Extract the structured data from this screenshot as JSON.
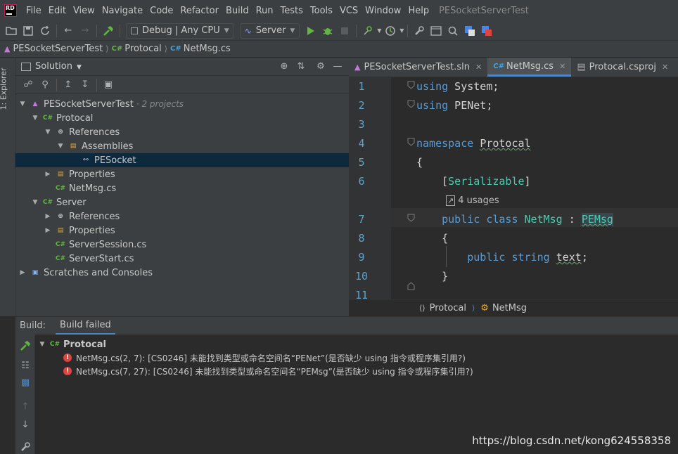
{
  "menubar": {
    "logo": "RD",
    "items": [
      "File",
      "Edit",
      "View",
      "Navigate",
      "Code",
      "Refactor",
      "Build",
      "Run",
      "Tests",
      "Tools",
      "VCS",
      "Window",
      "Help"
    ],
    "window_title": "PESocketServerTest"
  },
  "toolbar": {
    "config": "Debug | Any CPU",
    "run_target": "Server"
  },
  "breadcrumb": {
    "items": [
      "PESocketServerTest",
      "Protocal",
      "NetMsg.cs"
    ]
  },
  "left_stripe": {
    "tab": "1: Explorer"
  },
  "solution": {
    "title": "Solution",
    "tree": [
      {
        "label": "PESocketServerTest",
        "note": "· 2 projects"
      },
      {
        "label": "Protocal"
      },
      {
        "label": "References"
      },
      {
        "label": "Assemblies"
      },
      {
        "label": "PESocket"
      },
      {
        "label": "Properties"
      },
      {
        "label": "NetMsg.cs"
      },
      {
        "label": "Server"
      },
      {
        "label": "References"
      },
      {
        "label": "Properties"
      },
      {
        "label": "ServerSession.cs"
      },
      {
        "label": "ServerStart.cs"
      },
      {
        "label": "Scratches and Consoles"
      }
    ]
  },
  "editor": {
    "tabs": [
      "PESocketServerTest.sln",
      "NetMsg.cs",
      "Protocal.csproj",
      "C#"
    ],
    "line_numbers": [
      "1",
      "2",
      "3",
      "4",
      "5",
      "6",
      "7",
      "8",
      "9",
      "10",
      "11"
    ],
    "code": {
      "l1_kw": "using",
      "l1_rest": " System;",
      "l2_kw": "using",
      "l2_rest": " PENet;",
      "l4_kw": "namespace",
      "l4_name": "Protocal",
      "l5": "{",
      "l6_open": "[",
      "l6_attr": "Serializable",
      "l6_close": "]",
      "usages": "4 usages",
      "l7_kw1": "public",
      "l7_kw2": "class",
      "l7_name": "NetMsg",
      "l7_colon": " : ",
      "l7_base": "PEMsg",
      "l8": "{",
      "l9_kw1": "public",
      "l9_kw2": "string",
      "l9_field": "text",
      "l9_end": ";",
      "l10": "}"
    },
    "code_breadcrumb": [
      "Protocal",
      "NetMsg"
    ]
  },
  "build": {
    "label": "Build:",
    "tab": "Build failed",
    "project": "Protocal",
    "errors": [
      "NetMsg.cs(2, 7): [CS0246] 未能找到类型或命名空间名“PENet”(是否缺少 using 指令或程序集引用?)",
      "NetMsg.cs(7, 27): [CS0246] 未能找到类型或命名空间名“PEMsg”(是否缺少 using 指令或程序集引用?)"
    ]
  },
  "watermark": "https://blog.csdn.net/kong624558358",
  "colors": {
    "accent": "#4a88c7",
    "error": "#e0443e",
    "run": "#62b543",
    "keyword": "#569cd6"
  }
}
